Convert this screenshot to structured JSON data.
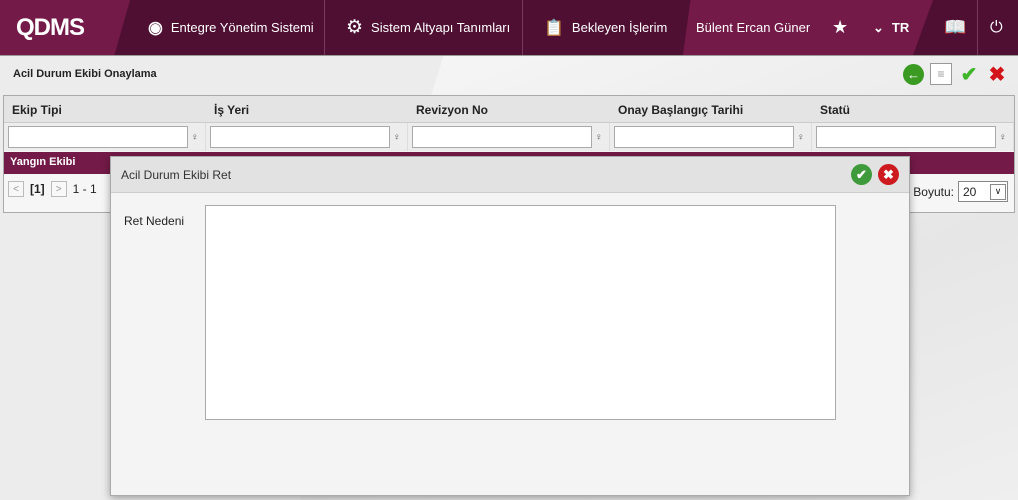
{
  "header": {
    "logo": "QDMS",
    "nav": [
      {
        "label": "Entegre Yönetim Sistemi",
        "icon": "qdms-icon"
      },
      {
        "label": "Sistem Altyapı Tanımları",
        "icon": "gear-icon"
      },
      {
        "label": "Bekleyen İşlerim",
        "icon": "clipboard-icon"
      }
    ],
    "user": "Bülent Ercan Güner",
    "language": "TR"
  },
  "page": {
    "title": "Acil Durum Ekibi Onaylama"
  },
  "grid": {
    "columns": [
      "Ekip Tipi",
      "İş Yeri",
      "Revizyon No",
      "Onay Başlangıç Tarihi",
      "Statü"
    ],
    "rows": [
      [
        "Yangın Ekibi"
      ]
    ],
    "pager": {
      "current": "[1]",
      "range": "1 - 1",
      "page_size_label": "a Boyutu:",
      "page_size": "20"
    }
  },
  "modal": {
    "title": "Acil Durum Ekibi Ret",
    "field_label": "Ret Nedeni",
    "field_value": ""
  },
  "colors": {
    "header": "#4f0f32",
    "accent": "#741a48"
  }
}
